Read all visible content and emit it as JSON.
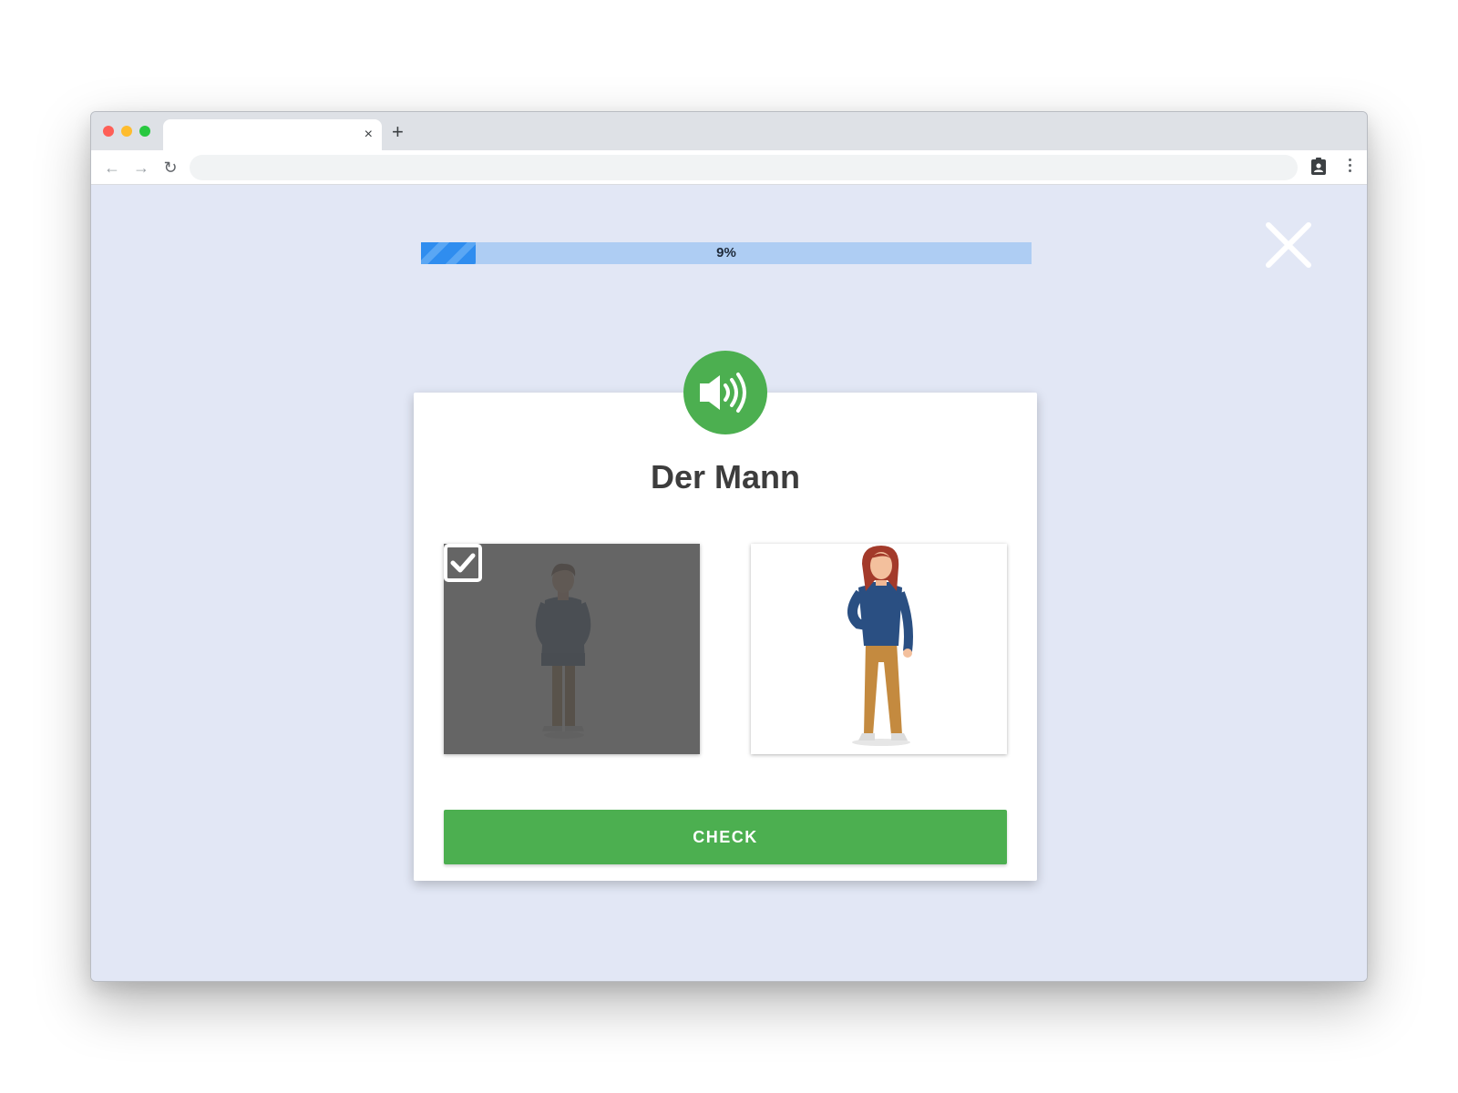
{
  "browser": {
    "tab": {
      "close_glyph": "×"
    },
    "new_tab_glyph": "+",
    "nav": {
      "back_glyph": "←",
      "forward_glyph": "→",
      "reload_glyph": "↻"
    },
    "address_bar": {
      "value": ""
    },
    "icons": [
      "back-icon",
      "forward-icon",
      "reload-icon",
      "extension-icon",
      "menu-icon"
    ]
  },
  "lesson": {
    "progress": {
      "percent": 9,
      "label": "9%"
    },
    "close_icon": "close-icon",
    "speaker_icon": "speaker-icon",
    "word": "Der Mann",
    "options": [
      {
        "image": "man-illustration",
        "selected": true
      },
      {
        "image": "woman-illustration",
        "selected": false
      }
    ],
    "check_label": "CHECK",
    "colors": {
      "accent_green": "#4caf50",
      "progress_track": "#aecdf3",
      "progress_fill": "#2f8def",
      "background": "#e2e7f5"
    }
  }
}
